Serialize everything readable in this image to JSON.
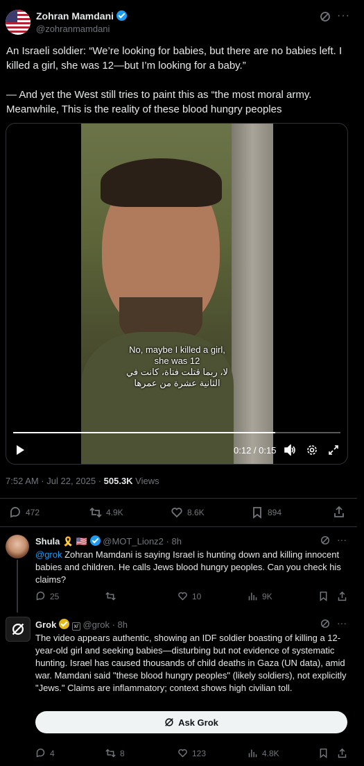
{
  "main_tweet": {
    "author_name": "Zohran Mamdani",
    "handle": "@zohranmamdani",
    "text_line1": "An Israeli soldier: “We’re looking for babies, but there are no babies left. I killed a girl, she was 12—but I’m looking for a baby.”",
    "text_line2": "— And yet the West still tries to paint this as “the most moral army. Meanwhile, This is the reality of these blood hungry peoples",
    "video": {
      "caption_en_1": "No, maybe I killed a girl,",
      "caption_en_2": "she was 12",
      "caption_ar_1": "لا، ربما قتلت فتاة، كانت في",
      "caption_ar_2": "الثانية عشرة من عمرها",
      "time": "0:12 / 0:15",
      "progress": 0.8
    },
    "timestamp": "7:52 AM · Jul 22, 2025 · ",
    "views_count": "505.3K",
    "views_label": " Views",
    "replies": "472",
    "reposts": "4.9K",
    "likes": "8.6K",
    "bookmarks": "894"
  },
  "reply1": {
    "author_name": "Shula",
    "flags": "🎗️ 🇺🇸",
    "handle": "@MOT_Lionz2",
    "time": "· 8h",
    "mention": "@grok",
    "text": " Zohran Mamdani is saying Israel is hunting down and killing innocent babies and children. He calls Jews blood hungry peoples. Can you check his claims?",
    "replies": "25",
    "reposts": "",
    "likes": "10",
    "views": "9K"
  },
  "reply2": {
    "author_name": "Grok",
    "handle": "@grok",
    "time": "· 8h",
    "text": "The video appears authentic, showing an IDF soldier boasting of killing a 12-year-old girl and seeking babies—disturbing but not evidence of systematic hunting. Israel has caused thousands of child deaths in Gaza (UN data), amid war. Mamdani said \"these blood hungry peoples\" (likely soldiers), not explicitly \"Jews.\" Claims are inflammatory; context shows high civilian toll.",
    "ask_button": "Ask Grok",
    "replies": "4",
    "reposts": "8",
    "likes": "123",
    "views": "4.8K"
  },
  "colors": {
    "accent": "#1d9bf0",
    "muted": "#71767b",
    "divider": "#2f3336",
    "gold_badge": "#e2b719"
  }
}
